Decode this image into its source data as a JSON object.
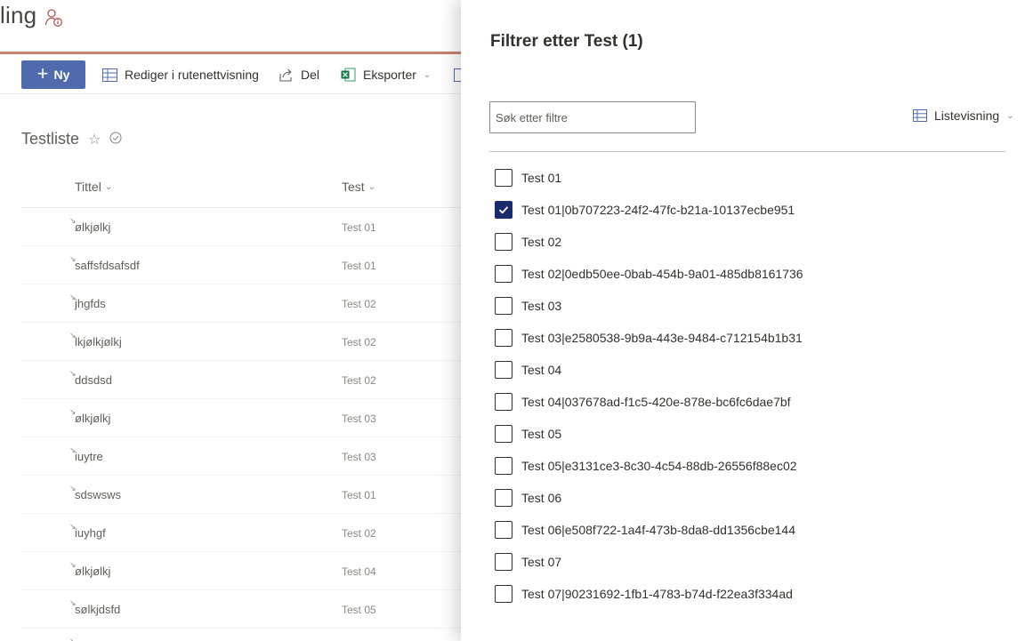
{
  "site": {
    "title": "ling"
  },
  "commands": {
    "new_label": "Ny",
    "grid_edit_label": "Rediger i rutenettvisning",
    "share_label": "Del",
    "export_label": "Eksporter"
  },
  "list": {
    "title": "Testliste",
    "columns": {
      "title": "Tittel",
      "test": "Test"
    },
    "rows": [
      {
        "title": "ølkjølkj",
        "test": "Test 01"
      },
      {
        "title": "saffsfdsafsdf",
        "test": "Test 01"
      },
      {
        "title": "jhgfds",
        "test": "Test 02"
      },
      {
        "title": "lkjølkjølkj",
        "test": "Test 02"
      },
      {
        "title": "ddsdsd",
        "test": "Test 02"
      },
      {
        "title": "ølkjølkj",
        "test": "Test 03"
      },
      {
        "title": "iuytre",
        "test": "Test 03"
      },
      {
        "title": "sdswsws",
        "test": "Test 01"
      },
      {
        "title": "iuyhgf",
        "test": "Test 02"
      },
      {
        "title": "ølkjølkj",
        "test": "Test 04"
      },
      {
        "title": "sølkjdsfd",
        "test": "Test 05"
      }
    ]
  },
  "filter_panel": {
    "title": "Filtrer etter Test (1)",
    "search_placeholder": "Søk etter filtre",
    "view_label": "Listevisning",
    "options": [
      {
        "label": "Test 01",
        "checked": false
      },
      {
        "label": "Test 01|0b707223-24f2-47fc-b21a-10137ecbe951",
        "checked": true
      },
      {
        "label": "Test 02",
        "checked": false
      },
      {
        "label": "Test 02|0edb50ee-0bab-454b-9a01-485db8161736",
        "checked": false
      },
      {
        "label": "Test 03",
        "checked": false
      },
      {
        "label": "Test 03|e2580538-9b9a-443e-9484-c712154b1b31",
        "checked": false
      },
      {
        "label": "Test 04",
        "checked": false
      },
      {
        "label": "Test 04|037678ad-f1c5-420e-878e-bc6fc6dae7bf",
        "checked": false
      },
      {
        "label": "Test 05",
        "checked": false
      },
      {
        "label": "Test 05|e3131ce3-8c30-4c54-88db-26556f88ec02",
        "checked": false
      },
      {
        "label": "Test 06",
        "checked": false
      },
      {
        "label": "Test 06|e508f722-1a4f-473b-8da8-dd1356cbe144",
        "checked": false
      },
      {
        "label": "Test 07",
        "checked": false
      },
      {
        "label": "Test 07|90231692-1fb1-4783-b74d-f22ea3f334ad",
        "checked": false
      }
    ]
  },
  "colors": {
    "accent": "#4f6bad",
    "checkbox_checked": "#1b2a6b",
    "header_line": "#c8826f"
  }
}
